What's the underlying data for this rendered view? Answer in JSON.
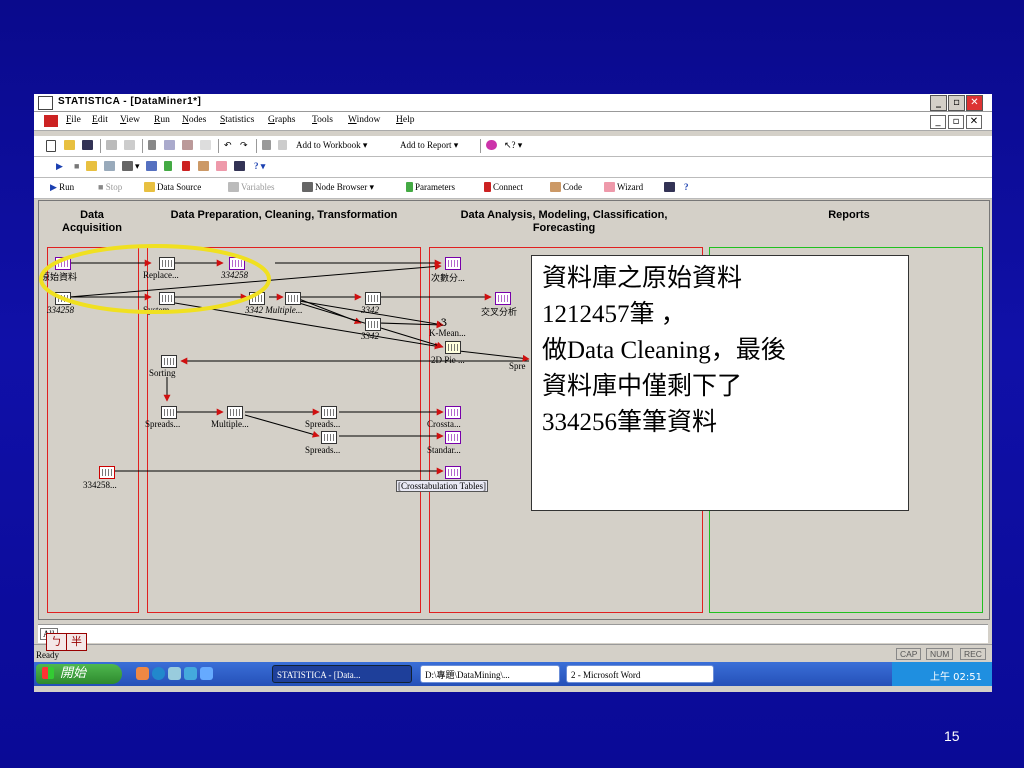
{
  "window": {
    "title": "STATISTICA - [DataMiner1*]",
    "app_icon": "STATISTICA"
  },
  "menu": {
    "icon": "STATISTICA",
    "items": [
      "File",
      "Edit",
      "View",
      "Run",
      "Nodes",
      "Statistics",
      "Graphs",
      "Tools",
      "Window",
      "Help"
    ]
  },
  "toolbar1": {
    "add_workbook": "Add to Workbook",
    "add_report": "Add to Report"
  },
  "toolbar3": {
    "run": "Run",
    "stop": "Stop",
    "data_source": "Data Source",
    "variables": "Variables",
    "node_browser": "Node Browser",
    "parameters": "Parameters",
    "connect": "Connect",
    "code": "Code",
    "wizard": "Wizard"
  },
  "columns": {
    "acquisition": "Data\nAcquisition",
    "preparation": "Data Preparation, Cleaning, Transformation",
    "analysis": "Data Analysis, Modeling, Classification,\nForecasting",
    "reports": "Reports"
  },
  "nodes": {
    "raw_data": "原始資料",
    "data_334258": "334258",
    "replace": "Replace...",
    "replace_out": "334258",
    "system": "System...",
    "multiple_3342": "3342 Multiple...",
    "out_3342a": "3342",
    "out_3342b": "3342",
    "sorting": "Sorting",
    "spreads1": "Spreads...",
    "multiple2": "Multiple...",
    "spreads2": "Spreads...",
    "spreads3": "Spreads...",
    "data_334258b": "334258...",
    "cross1": "次數分...",
    "cross2": "交叉分析",
    "kmeans": "K-Mean...",
    "pie": "2D Pie ...",
    "spre": "Spre",
    "crossta": "Crossta...",
    "standar": "Standar...",
    "crosstab_tables": "[Crosstabulation Tables]"
  },
  "annotation": {
    "lines": [
      "資料庫之原始資料",
      "1212457筆 ，",
      "做Data Cleaning，最後",
      "資料庫中僅剩下了",
      "334256筆筆資料"
    ]
  },
  "tabs": {
    "all": "All"
  },
  "status": {
    "ready": "Ready",
    "ime": [
      "ㄅ",
      "半"
    ],
    "caps": "CAP",
    "num": "NUM",
    "rec": "REC"
  },
  "taskbar": {
    "start": "開始",
    "tasks": [
      "STATISTICA - [Data...",
      "D:\\專題\\DataMining\\...",
      "2 - Microsoft Word"
    ],
    "clock": "上午 02:51"
  },
  "slide": {
    "page_number": "15"
  },
  "colors": {
    "slide_bg": "#0a0a8c",
    "highlight_ellipse": "#f0e020",
    "column_box": "#e02020",
    "report_box": "#20c020"
  }
}
